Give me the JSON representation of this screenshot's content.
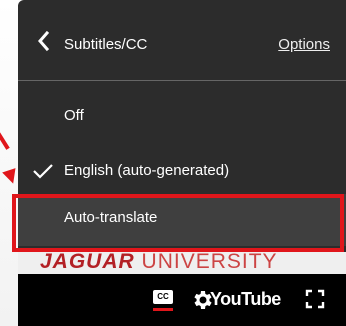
{
  "menu": {
    "title": "Subtitles/CC",
    "options_label": "Options",
    "items": [
      {
        "label": "Off",
        "selected": false
      },
      {
        "label": "English (auto-generated)",
        "selected": true
      },
      {
        "label": "Auto-translate",
        "selected": false,
        "highlighted": true
      }
    ]
  },
  "banner": {
    "left_text": "JAGUAR",
    "right_text": "UNIVERSITY"
  },
  "controls": {
    "cc_label": "CC",
    "logo_text": "YouTube"
  },
  "colors": {
    "highlight": "#e0161b",
    "menu_bg": "#1c1c1c",
    "controls_bg": "#000000"
  },
  "icons": [
    "chevron-left-icon",
    "checkmark-icon",
    "cc-icon",
    "gear-icon",
    "fullscreen-icon"
  ]
}
